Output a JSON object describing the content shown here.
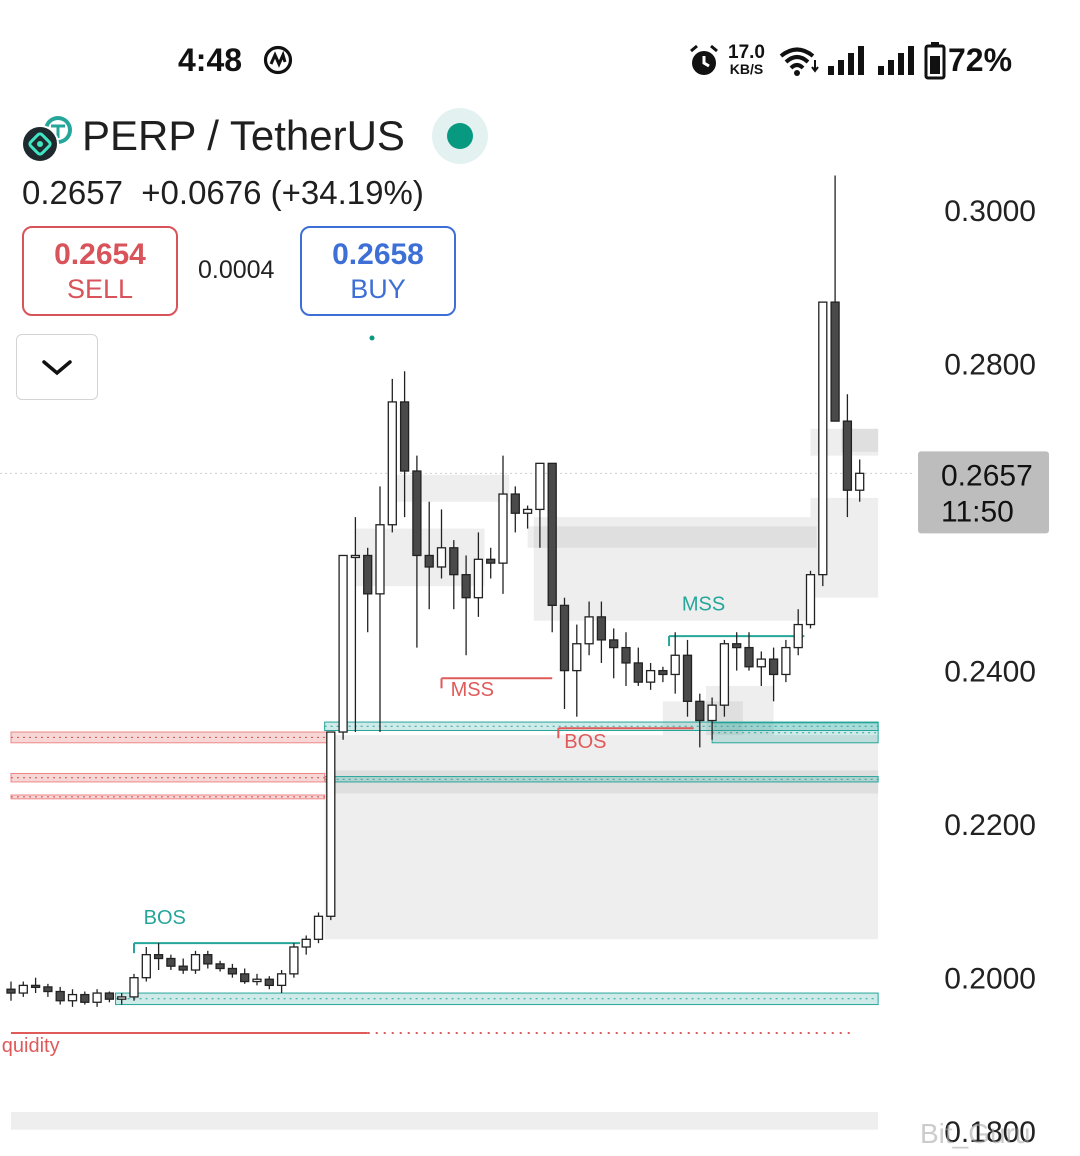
{
  "status_bar": {
    "time": "4:48",
    "net_speed_value": "17.0",
    "net_speed_unit": "KB/S",
    "battery": "72%",
    "icons": [
      "threads-icon",
      "alarm-icon",
      "wifi-icon",
      "signal-icon",
      "signal-icon",
      "battery-icon"
    ]
  },
  "header": {
    "symbol": "PERP / TetherUS",
    "last_price": "0.2657",
    "change": "+0.0676 (+34.19%)",
    "status_color": "#089981"
  },
  "trade": {
    "sell_price": "0.2654",
    "sell_label": "SELL",
    "spread": "0.0004",
    "buy_price": "0.2658",
    "buy_label": "BUY"
  },
  "watermark": "Bit_Guru",
  "chart_data": {
    "type": "candlestick",
    "y_axis": {
      "ticks": [
        "0.3000",
        "0.2800",
        "0.2400",
        "0.2200",
        "0.2000",
        "0.1800"
      ],
      "range": [
        0.178,
        0.305
      ],
      "side": "right"
    },
    "current_price": {
      "price": "0.2657",
      "countdown": "11:50"
    },
    "colors": {
      "up": "#ffffff",
      "down": "#4a4a4a",
      "bull_label": "#26a69a",
      "bear_label": "#e05a5a"
    },
    "candles": [
      [
        0.1985,
        0.1995,
        0.197,
        0.198
      ],
      [
        0.198,
        0.1995,
        0.1975,
        0.199
      ],
      [
        0.199,
        0.2,
        0.198,
        0.1988
      ],
      [
        0.1988,
        0.1992,
        0.1975,
        0.1982
      ],
      [
        0.1982,
        0.1988,
        0.1965,
        0.197
      ],
      [
        0.197,
        0.1985,
        0.1962,
        0.1978
      ],
      [
        0.1978,
        0.1982,
        0.1965,
        0.1968
      ],
      [
        0.1968,
        0.1985,
        0.1962,
        0.198
      ],
      [
        0.198,
        0.1982,
        0.1968,
        0.1972
      ],
      [
        0.1972,
        0.198,
        0.1965,
        0.1975
      ],
      [
        0.1975,
        0.2005,
        0.197,
        0.2
      ],
      [
        0.2,
        0.204,
        0.1995,
        0.203
      ],
      [
        0.203,
        0.2045,
        0.201,
        0.2025
      ],
      [
        0.2025,
        0.203,
        0.201,
        0.2015
      ],
      [
        0.2015,
        0.2025,
        0.2005,
        0.201
      ],
      [
        0.201,
        0.2035,
        0.2005,
        0.203
      ],
      [
        0.203,
        0.2035,
        0.2012,
        0.2018
      ],
      [
        0.2018,
        0.2022,
        0.2008,
        0.2012
      ],
      [
        0.2012,
        0.2018,
        0.2,
        0.2005
      ],
      [
        0.2005,
        0.2012,
        0.1992,
        0.1995
      ],
      [
        0.1995,
        0.2005,
        0.199,
        0.1998
      ],
      [
        0.1998,
        0.2002,
        0.1985,
        0.199
      ],
      [
        0.199,
        0.201,
        0.198,
        0.2005
      ],
      [
        0.2005,
        0.2045,
        0.2,
        0.204
      ],
      [
        0.204,
        0.2055,
        0.203,
        0.205
      ],
      [
        0.205,
        0.2085,
        0.2045,
        0.208
      ],
      [
        0.208,
        0.232,
        0.2075,
        0.232
      ],
      [
        0.232,
        0.254,
        0.231,
        0.255
      ],
      [
        0.255,
        0.26,
        0.232,
        0.255
      ],
      [
        0.255,
        0.256,
        0.245,
        0.25
      ],
      [
        0.25,
        0.264,
        0.232,
        0.259
      ],
      [
        0.259,
        0.278,
        0.258,
        0.275
      ],
      [
        0.275,
        0.279,
        0.26,
        0.266
      ],
      [
        0.266,
        0.268,
        0.243,
        0.255
      ],
      [
        0.255,
        0.262,
        0.248,
        0.2535
      ],
      [
        0.2535,
        0.261,
        0.252,
        0.256
      ],
      [
        0.256,
        0.257,
        0.248,
        0.2525
      ],
      [
        0.2525,
        0.255,
        0.242,
        0.2495
      ],
      [
        0.2495,
        0.258,
        0.247,
        0.2545
      ],
      [
        0.2545,
        0.256,
        0.252,
        0.254
      ],
      [
        0.254,
        0.268,
        0.25,
        0.263
      ],
      [
        0.263,
        0.264,
        0.258,
        0.2605
      ],
      [
        0.2605,
        0.2615,
        0.2585,
        0.261
      ],
      [
        0.261,
        0.264,
        0.256,
        0.267
      ],
      [
        0.267,
        0.265,
        0.245,
        0.2485
      ],
      [
        0.2485,
        0.2495,
        0.235,
        0.24
      ],
      [
        0.24,
        0.246,
        0.234,
        0.2435
      ],
      [
        0.2435,
        0.249,
        0.242,
        0.247
      ],
      [
        0.247,
        0.249,
        0.241,
        0.244
      ],
      [
        0.244,
        0.2455,
        0.239,
        0.243
      ],
      [
        0.243,
        0.245,
        0.238,
        0.241
      ],
      [
        0.241,
        0.243,
        0.238,
        0.2385
      ],
      [
        0.2385,
        0.241,
        0.2375,
        0.24
      ],
      [
        0.24,
        0.2405,
        0.2385,
        0.2395
      ],
      [
        0.2395,
        0.245,
        0.237,
        0.242
      ],
      [
        0.242,
        0.244,
        0.234,
        0.236
      ],
      [
        0.236,
        0.237,
        0.23,
        0.2335
      ],
      [
        0.2335,
        0.2365,
        0.231,
        0.2355
      ],
      [
        0.2355,
        0.244,
        0.234,
        0.2435
      ],
      [
        0.2435,
        0.245,
        0.24,
        0.243
      ],
      [
        0.243,
        0.245,
        0.24,
        0.2405
      ],
      [
        0.2405,
        0.2425,
        0.238,
        0.2415
      ],
      [
        0.2415,
        0.243,
        0.236,
        0.2395
      ],
      [
        0.2395,
        0.244,
        0.2385,
        0.243
      ],
      [
        0.243,
        0.248,
        0.242,
        0.246
      ],
      [
        0.246,
        0.253,
        0.2455,
        0.2525
      ],
      [
        0.2525,
        0.277,
        0.251,
        0.288
      ],
      [
        0.288,
        0.3045,
        0.28,
        0.2725
      ],
      [
        0.2725,
        0.276,
        0.26,
        0.2635
      ],
      [
        0.2635,
        0.2675,
        0.262,
        0.2657
      ]
    ],
    "zones": [
      {
        "from": 25.5,
        "to": 70.5,
        "low": 0.205,
        "high": 0.227
      },
      {
        "from": 25.8,
        "to": 70.5,
        "low": 0.224,
        "high": 0.225
      },
      {
        "from": 26.0,
        "to": 70.5,
        "low": 0.225,
        "high": 0.2316
      },
      {
        "from": 28.0,
        "to": 38.5,
        "low": 0.251,
        "high": 0.2585
      },
      {
        "from": 31.0,
        "to": 40.5,
        "low": 0.262,
        "high": 0.2655
      },
      {
        "from": 42.0,
        "to": 65.5,
        "low": 0.256,
        "high": 0.2588
      },
      {
        "from": 42.5,
        "to": 65.0,
        "low": 0.2465,
        "high": 0.26
      },
      {
        "from": 53.0,
        "to": 59.5,
        "low": 0.2316,
        "high": 0.236
      },
      {
        "from": 56.5,
        "to": 62.0,
        "low": 0.2316,
        "high": 0.238
      },
      {
        "from": 65.0,
        "to": 70.5,
        "low": 0.2495,
        "high": 0.2625
      },
      {
        "from": 65.0,
        "to": 70.5,
        "low": 0.268,
        "high": 0.2715
      },
      {
        "from": 67.5,
        "to": 70.5,
        "low": 0.2685,
        "high": 0.2715
      },
      {
        "from": 0.0,
        "to": 70.5,
        "low": 0.1802,
        "high": 0.1825
      }
    ],
    "bull_zones": [
      {
        "from": 8.5,
        "to": 70.5,
        "low": 0.1965,
        "high": 0.198
      },
      {
        "from": 57.0,
        "to": 70.5,
        "low": 0.2306,
        "high": 0.2332
      },
      {
        "from": 25.5,
        "to": 70.5,
        "low": 0.2322,
        "high": 0.2333
      },
      {
        "from": 25.5,
        "to": 70.5,
        "low": 0.2255,
        "high": 0.2262
      }
    ],
    "bear_zones": [
      {
        "from": 0.0,
        "to": 25.7,
        "low": 0.2306,
        "high": 0.232
      },
      {
        "from": 0.0,
        "to": 25.5,
        "low": 0.2255,
        "high": 0.2266
      },
      {
        "from": 0.0,
        "to": 25.5,
        "low": 0.2233,
        "high": 0.2238
      }
    ],
    "lines": [
      {
        "from": 10.0,
        "to": 23.5,
        "price": 0.2045,
        "color": "#26a69a"
      },
      {
        "from": 35.0,
        "to": 44.0,
        "price": 0.239,
        "color": "#e05a5a"
      },
      {
        "from": 44.5,
        "to": 55.5,
        "price": 0.2325,
        "color": "#e05a5a"
      },
      {
        "from": 53.5,
        "to": 64.5,
        "price": 0.2445,
        "color": "#26a69a"
      },
      {
        "from": 0.0,
        "to": 29.0,
        "price": 0.1928,
        "color": "#e05a5a"
      }
    ],
    "labels": [
      {
        "text": "BOS",
        "at": 12.5,
        "price": 0.207,
        "color": "#26a69a"
      },
      {
        "text": "MSS",
        "at": 37.5,
        "price": 0.2367,
        "color": "#e05a5a"
      },
      {
        "text": "BOS",
        "at": 46.7,
        "price": 0.2299,
        "color": "#e05a5a"
      },
      {
        "text": "MSS",
        "at": 56.3,
        "price": 0.2478,
        "color": "#26a69a"
      },
      {
        "text": "quidity",
        "at": 1.6,
        "price": 0.1903,
        "color": "#e05a5a"
      }
    ]
  }
}
